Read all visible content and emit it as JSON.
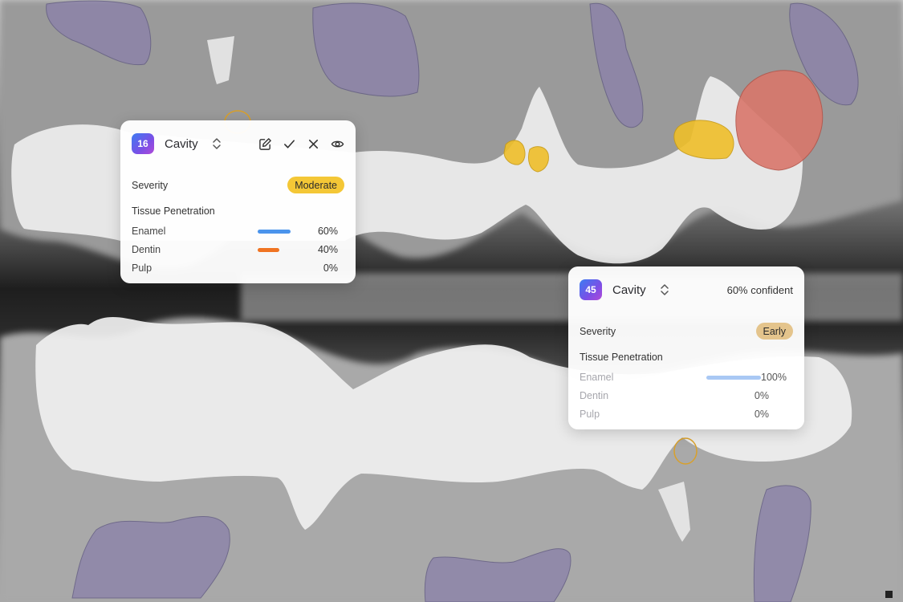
{
  "colors": {
    "enamel": "#4b94ec",
    "dentin": "#f07422",
    "enamel_light": "#a9c8f4",
    "moderate": "#f4c736",
    "early": "#e4c48c",
    "lesion_yellow": "#efbf2a",
    "lesion_red": "#d9776b",
    "region_purple": "#8a80aa"
  },
  "findings": [
    {
      "number": "16",
      "type": "Cavity",
      "severity_label": "Severity",
      "severity": "Moderate",
      "tissue_title": "Tissue Penetration",
      "actions": [
        "edit-icon",
        "check-icon",
        "close-icon",
        "eye-icon"
      ],
      "tissues": [
        {
          "name": "Enamel",
          "percent_label": "60%",
          "value": 0.6
        },
        {
          "name": "Dentin",
          "percent_label": "40%",
          "value": 0.4
        },
        {
          "name": "Pulp",
          "percent_label": "0%",
          "value": 0.0
        }
      ]
    },
    {
      "number": "45",
      "type": "Cavity",
      "confidence": "60% confident",
      "severity_label": "Severity",
      "severity": "Early",
      "tissue_title": "Tissue Penetration",
      "tissues": [
        {
          "name": "Enamel",
          "percent_label": "100%",
          "value": 1.0
        },
        {
          "name": "Dentin",
          "percent_label": "0%",
          "value": 0.0
        },
        {
          "name": "Pulp",
          "percent_label": "0%",
          "value": 0.0
        }
      ]
    }
  ]
}
